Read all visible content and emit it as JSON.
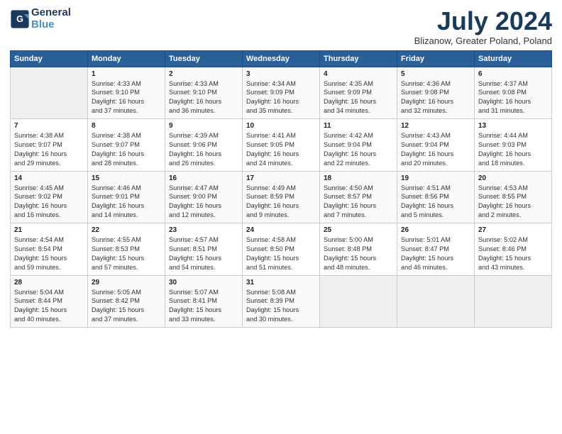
{
  "header": {
    "logo_line1": "General",
    "logo_line2": "Blue",
    "main_title": "July 2024",
    "subtitle": "Blizanow, Greater Poland, Poland"
  },
  "columns": [
    "Sunday",
    "Monday",
    "Tuesday",
    "Wednesday",
    "Thursday",
    "Friday",
    "Saturday"
  ],
  "weeks": [
    [
      {
        "num": "",
        "info": ""
      },
      {
        "num": "1",
        "info": "Sunrise: 4:33 AM\nSunset: 9:10 PM\nDaylight: 16 hours\nand 37 minutes."
      },
      {
        "num": "2",
        "info": "Sunrise: 4:33 AM\nSunset: 9:10 PM\nDaylight: 16 hours\nand 36 minutes."
      },
      {
        "num": "3",
        "info": "Sunrise: 4:34 AM\nSunset: 9:09 PM\nDaylight: 16 hours\nand 35 minutes."
      },
      {
        "num": "4",
        "info": "Sunrise: 4:35 AM\nSunset: 9:09 PM\nDaylight: 16 hours\nand 34 minutes."
      },
      {
        "num": "5",
        "info": "Sunrise: 4:36 AM\nSunset: 9:08 PM\nDaylight: 16 hours\nand 32 minutes."
      },
      {
        "num": "6",
        "info": "Sunrise: 4:37 AM\nSunset: 9:08 PM\nDaylight: 16 hours\nand 31 minutes."
      }
    ],
    [
      {
        "num": "7",
        "info": "Sunrise: 4:38 AM\nSunset: 9:07 PM\nDaylight: 16 hours\nand 29 minutes."
      },
      {
        "num": "8",
        "info": "Sunrise: 4:38 AM\nSunset: 9:07 PM\nDaylight: 16 hours\nand 28 minutes."
      },
      {
        "num": "9",
        "info": "Sunrise: 4:39 AM\nSunset: 9:06 PM\nDaylight: 16 hours\nand 26 minutes."
      },
      {
        "num": "10",
        "info": "Sunrise: 4:41 AM\nSunset: 9:05 PM\nDaylight: 16 hours\nand 24 minutes."
      },
      {
        "num": "11",
        "info": "Sunrise: 4:42 AM\nSunset: 9:04 PM\nDaylight: 16 hours\nand 22 minutes."
      },
      {
        "num": "12",
        "info": "Sunrise: 4:43 AM\nSunset: 9:04 PM\nDaylight: 16 hours\nand 20 minutes."
      },
      {
        "num": "13",
        "info": "Sunrise: 4:44 AM\nSunset: 9:03 PM\nDaylight: 16 hours\nand 18 minutes."
      }
    ],
    [
      {
        "num": "14",
        "info": "Sunrise: 4:45 AM\nSunset: 9:02 PM\nDaylight: 16 hours\nand 16 minutes."
      },
      {
        "num": "15",
        "info": "Sunrise: 4:46 AM\nSunset: 9:01 PM\nDaylight: 16 hours\nand 14 minutes."
      },
      {
        "num": "16",
        "info": "Sunrise: 4:47 AM\nSunset: 9:00 PM\nDaylight: 16 hours\nand 12 minutes."
      },
      {
        "num": "17",
        "info": "Sunrise: 4:49 AM\nSunset: 8:59 PM\nDaylight: 16 hours\nand 9 minutes."
      },
      {
        "num": "18",
        "info": "Sunrise: 4:50 AM\nSunset: 8:57 PM\nDaylight: 16 hours\nand 7 minutes."
      },
      {
        "num": "19",
        "info": "Sunrise: 4:51 AM\nSunset: 8:56 PM\nDaylight: 16 hours\nand 5 minutes."
      },
      {
        "num": "20",
        "info": "Sunrise: 4:53 AM\nSunset: 8:55 PM\nDaylight: 16 hours\nand 2 minutes."
      }
    ],
    [
      {
        "num": "21",
        "info": "Sunrise: 4:54 AM\nSunset: 8:54 PM\nDaylight: 15 hours\nand 59 minutes."
      },
      {
        "num": "22",
        "info": "Sunrise: 4:55 AM\nSunset: 8:53 PM\nDaylight: 15 hours\nand 57 minutes."
      },
      {
        "num": "23",
        "info": "Sunrise: 4:57 AM\nSunset: 8:51 PM\nDaylight: 15 hours\nand 54 minutes."
      },
      {
        "num": "24",
        "info": "Sunrise: 4:58 AM\nSunset: 8:50 PM\nDaylight: 15 hours\nand 51 minutes."
      },
      {
        "num": "25",
        "info": "Sunrise: 5:00 AM\nSunset: 8:48 PM\nDaylight: 15 hours\nand 48 minutes."
      },
      {
        "num": "26",
        "info": "Sunrise: 5:01 AM\nSunset: 8:47 PM\nDaylight: 15 hours\nand 46 minutes."
      },
      {
        "num": "27",
        "info": "Sunrise: 5:02 AM\nSunset: 8:46 PM\nDaylight: 15 hours\nand 43 minutes."
      }
    ],
    [
      {
        "num": "28",
        "info": "Sunrise: 5:04 AM\nSunset: 8:44 PM\nDaylight: 15 hours\nand 40 minutes."
      },
      {
        "num": "29",
        "info": "Sunrise: 5:05 AM\nSunset: 8:42 PM\nDaylight: 15 hours\nand 37 minutes."
      },
      {
        "num": "30",
        "info": "Sunrise: 5:07 AM\nSunset: 8:41 PM\nDaylight: 15 hours\nand 33 minutes."
      },
      {
        "num": "31",
        "info": "Sunrise: 5:08 AM\nSunset: 8:39 PM\nDaylight: 15 hours\nand 30 minutes."
      },
      {
        "num": "",
        "info": ""
      },
      {
        "num": "",
        "info": ""
      },
      {
        "num": "",
        "info": ""
      }
    ]
  ]
}
